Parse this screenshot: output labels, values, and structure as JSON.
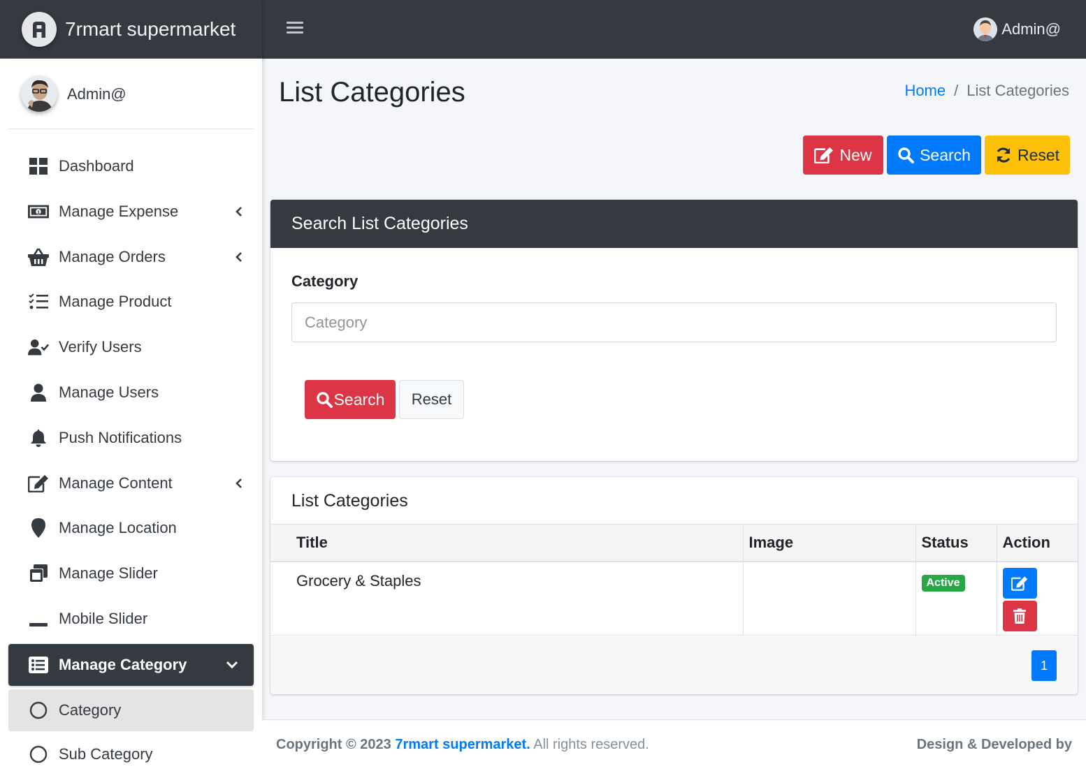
{
  "header": {
    "brand": "7rmart supermarket",
    "user_name": "Admin@",
    "menu_icon": "hamburger-icon"
  },
  "sidebar": {
    "user_name": "Admin@",
    "items": [
      {
        "label": "Dashboard",
        "icon": "dashboard-icon"
      },
      {
        "label": "Manage Expense",
        "icon": "money-icon"
      },
      {
        "label": "Manage Orders",
        "icon": "basket-icon"
      },
      {
        "label": "Manage Product",
        "icon": "list-check-icon"
      },
      {
        "label": "Verify Users",
        "icon": "user-check-icon"
      },
      {
        "label": "Manage Users",
        "icon": "user-icon"
      },
      {
        "label": "Push Notifications",
        "icon": "bell-icon"
      },
      {
        "label": "Manage Content",
        "icon": "edit-icon"
      },
      {
        "label": "Manage Location",
        "icon": "map-pin-icon"
      },
      {
        "label": "Manage Slider",
        "icon": "windows-icon"
      },
      {
        "label": "Mobile Slider",
        "icon": "minus-icon"
      },
      {
        "label": "Manage Category",
        "icon": "list-alt-icon"
      },
      {
        "label": "Category",
        "icon": "circle-icon"
      },
      {
        "label": "Sub Category",
        "icon": "circle-icon"
      }
    ]
  },
  "page": {
    "title": "List Categories",
    "breadcrumb": {
      "home": "Home",
      "separator": "/",
      "current": "List Categories"
    }
  },
  "toolbar": {
    "new_label": "New",
    "search_label": "Search",
    "reset_label": "Reset"
  },
  "search_card": {
    "title": "Search List Categories",
    "field_label": "Category",
    "field_placeholder": "Category",
    "field_value": "",
    "search_label": "Search",
    "reset_label": "Reset"
  },
  "list_card": {
    "title": "List Categories",
    "columns": [
      "Title",
      "Image",
      "Status",
      "Action"
    ],
    "rows": [
      {
        "title": "Grocery & Staples",
        "image": "",
        "status": "Active"
      }
    ],
    "pagination": {
      "current": "1"
    }
  },
  "footer": {
    "copyright_prefix": "Copyright © 2023",
    "brand": "7rmart supermarket.",
    "suffix": "All rights reserved.",
    "right": "Design & Developed by"
  },
  "colors": {
    "dark": "#343a40",
    "primary": "#007bff",
    "danger": "#dc3545",
    "warning": "#ffc107",
    "success": "#28a745"
  }
}
